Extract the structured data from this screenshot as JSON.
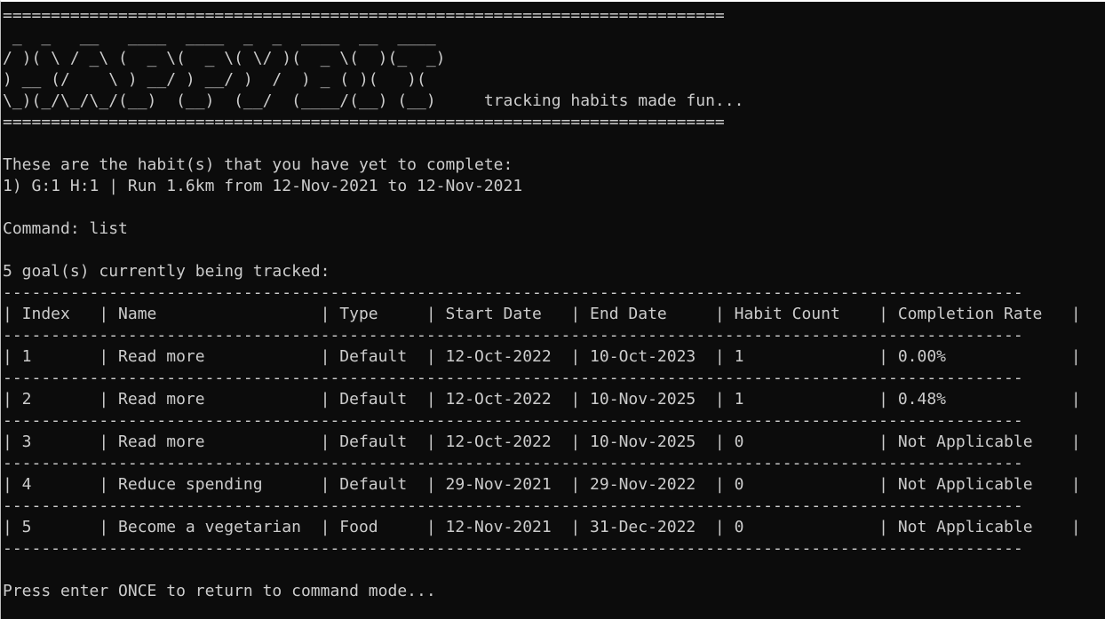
{
  "banner": {
    "rule": "===========================================================================",
    "art": [
      " _  _   __   ____  ____  _  _  ____  __  ____ ",
      "/ )( \\ / _\\ (  _ \\(  _ \\( \\/ )(  _ \\(  )(_  _)",
      ") __ (/    \\ ) __/ ) __/ )  /  ) _ ( )(   )(  ",
      "\\_)(_/\\_/\\_/(__)  (__)  (__/  (____/(__) (__)     tracking habits made fun..."
    ]
  },
  "pending": {
    "heading": "These are the habit(s) that you have yet to complete:",
    "items": [
      "1) G:1 H:1 | Run 1.6km from 12-Nov-2021 to 12-Nov-2021"
    ]
  },
  "command": {
    "line": "Command: list"
  },
  "goals": {
    "summary": "5 goal(s) currently being tracked:",
    "separator": "----------------------------------------------------------------------------------------------------------",
    "header": "| Index   | Name                 | Type     | Start Date   | End Date     | Habit Count    | Completion Rate   |",
    "rows": [
      "| 1       | Read more            | Default  | 12-Oct-2022  | 10-Oct-2023  | 1              | 0.00%             |",
      "| 2       | Read more            | Default  | 12-Oct-2022  | 10-Nov-2025  | 1              | 0.48%             |",
      "| 3       | Read more            | Default  | 12-Oct-2022  | 10-Nov-2025  | 0              | Not Applicable    |",
      "| 4       | Reduce spending      | Default  | 29-Nov-2021  | 29-Nov-2022  | 0              | Not Applicable    |",
      "| 5       | Become a vegetarian  | Food     | 12-Nov-2021  | 31-Dec-2022  | 0              | Not Applicable    |"
    ]
  },
  "footer": {
    "prompt": "Press enter ONCE to return to command mode..."
  }
}
